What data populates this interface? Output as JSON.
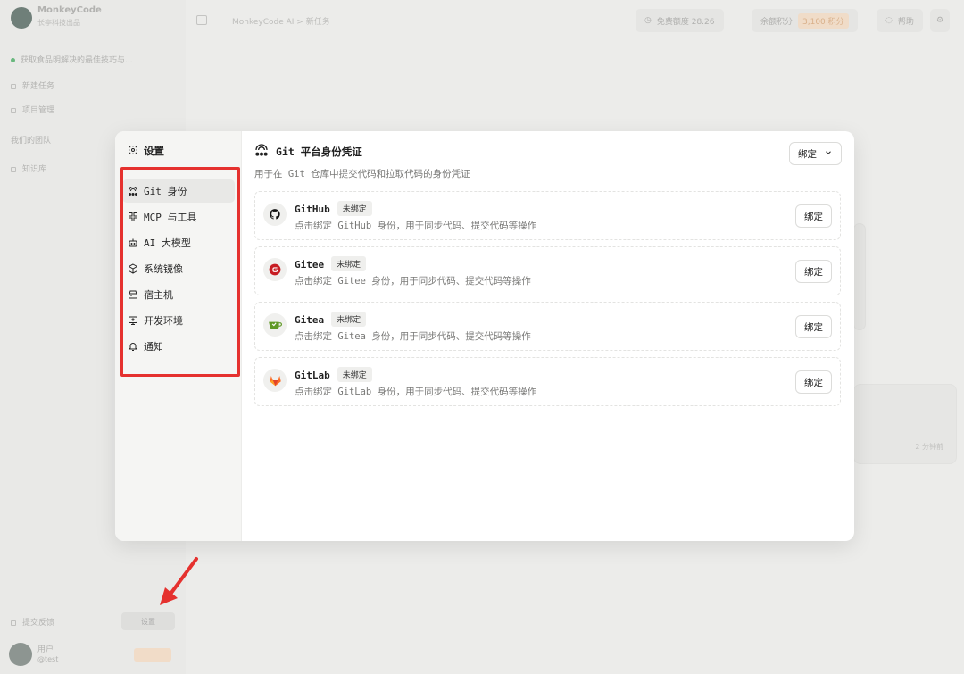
{
  "background": {
    "app_name": "MonkeyCode",
    "app_sub": "长亭科技出品",
    "sidebar_items": [
      "获取食品明解决的最佳技巧与...",
      "新建任务",
      "项目管理",
      "我们的团队",
      "知识库"
    ],
    "breadcrumb": "MonkeyCode AI  >  新任务",
    "free_quota": "免费额度 28.26",
    "balance_label": "余额积分",
    "balance_value": "3,100 积分",
    "help": "帮助",
    "bottom_left": "提交反馈",
    "settings_btn": "设置",
    "user_name": "用户",
    "user_sub": "@test",
    "card_text": "2 分钟前"
  },
  "dialog": {
    "sidebar_title": "设置",
    "nav": [
      {
        "label": "Git 身份",
        "icon": "git-identity-icon"
      },
      {
        "label": "MCP 与工具",
        "icon": "tools-icon"
      },
      {
        "label": "AI 大模型",
        "icon": "robot-icon"
      },
      {
        "label": "系统镜像",
        "icon": "cube-icon"
      },
      {
        "label": "宿主机",
        "icon": "server-icon"
      },
      {
        "label": "开发环境",
        "icon": "monitor-icon"
      },
      {
        "label": "通知",
        "icon": "bell-icon"
      }
    ],
    "content_title": "Git 平台身份凭证",
    "content_subtitle": "用于在 Git 仓库中提交代码和拉取代码的身份凭证",
    "bind_select_label": "绑定",
    "platforms": [
      {
        "name": "GitHub",
        "status": "未绑定",
        "desc": "点击绑定 GitHub 身份，用于同步代码、提交代码等操作",
        "button": "绑定",
        "color": "#111111"
      },
      {
        "name": "Gitee",
        "status": "未绑定",
        "desc": "点击绑定 Gitee 身份，用于同步代码、提交代码等操作",
        "button": "绑定",
        "color": "#c71d23"
      },
      {
        "name": "Gitea",
        "status": "未绑定",
        "desc": "点击绑定 Gitea 身份，用于同步代码、提交代码等操作",
        "button": "绑定",
        "color": "#609926"
      },
      {
        "name": "GitLab",
        "status": "未绑定",
        "desc": "点击绑定 GitLab 身份，用于同步代码、提交代码等操作",
        "button": "绑定",
        "color": "#fc6d26"
      }
    ]
  },
  "colors": {
    "highlight": "#e5312e",
    "arrow": "#e5312e"
  }
}
